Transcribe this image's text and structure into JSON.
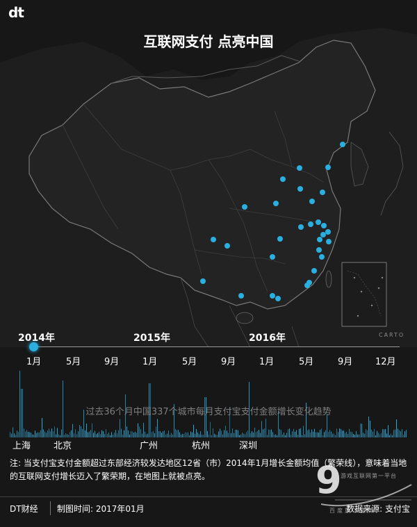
{
  "header": {
    "logo": "dt",
    "title": "互联网支付 点亮中国"
  },
  "map": {
    "attribution": "CARTO",
    "colors": {
      "background": "#171717",
      "land": "#222222",
      "border": "#6a6a6a",
      "city_dot": "#2ab0e0"
    }
  },
  "timeline": {
    "years": [
      "2014年",
      "2015年",
      "2016年"
    ],
    "months": [
      "1月",
      "5月",
      "9月",
      "1月",
      "5月",
      "9月",
      "1月",
      "5月",
      "9月",
      "12月"
    ],
    "current_position": 0
  },
  "chart": {
    "caption": "过去36个月中国337个城市每月支付宝支付金额增长变化趋势",
    "cities": [
      "上海",
      "北京",
      "广州",
      "杭州",
      "深圳"
    ],
    "colors": {
      "bar": "#2ab0e0"
    }
  },
  "note": {
    "text": "注: 当支付宝支付金额超过东部经济较发达地区12省（市）2014年1月增长金额均值（繁荣线），意味着当地的互联网支付增长迈入了繁荣期，在地图上就被点亮。"
  },
  "footer": {
    "brand": "DT财经",
    "date": "制图时间: 2017年01月",
    "source": "数据来源: 支付宝"
  },
  "watermark": {
    "mark": "9",
    "tagline": "游戏互联网第一平台",
    "subtitle": "百度旗下品牌"
  }
}
